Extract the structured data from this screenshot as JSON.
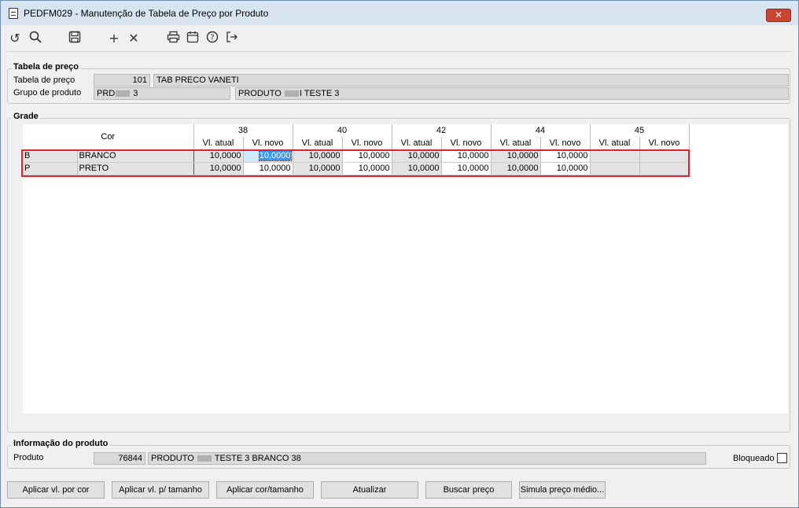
{
  "window": {
    "title": "PEDFM029 - Manutenção de Tabela de Preço por Produto",
    "close_label": "✕"
  },
  "toolbar": {
    "icons": [
      "refresh-icon",
      "search-icon",
      "save-icon",
      "add-icon",
      "delete-icon",
      "print-icon",
      "calendar-icon",
      "help-icon",
      "exit-icon"
    ]
  },
  "tabela_preco": {
    "legend": "Tabela de preço",
    "tabela_label": "Tabela de preço",
    "tabela_code": "101",
    "tabela_name": "TAB PRECO VANETI",
    "grupo_label": "Grupo de produto",
    "grupo_code_prefix": "PRD",
    "grupo_code_suffix": "3",
    "grupo_name_prefix": "PRODUTO",
    "grupo_name_suffix": "I TESTE 3"
  },
  "grade": {
    "legend": "Grade",
    "cor_header": "Cor",
    "sizes": [
      "38",
      "40",
      "42",
      "44",
      "45"
    ],
    "sub_atual": "Vl. atual",
    "sub_novo": "Vl. novo",
    "rows": [
      {
        "code": "B",
        "name": "BRANCO",
        "values": [
          "10,0000",
          "10,0000",
          "10,0000",
          "10,0000",
          "10,0000",
          "10,0000",
          "10,0000",
          "10,0000",
          "",
          ""
        ]
      },
      {
        "code": "P",
        "name": "PRETO",
        "values": [
          "10,0000",
          "10,0000",
          "10,0000",
          "10,0000",
          "10,0000",
          "10,0000",
          "10,0000",
          "10,0000",
          "",
          ""
        ]
      }
    ]
  },
  "produto_info": {
    "legend": "Informação do produto",
    "produto_label": "Produto",
    "produto_code": "76844",
    "produto_name_prefix": "PRODUTO",
    "produto_name_suffix": "TESTE 3 BRANCO 38",
    "bloqueado_label": "Bloqueado"
  },
  "buttons": {
    "aplicar_cor": "Aplicar vl. por cor",
    "aplicar_tamanho": "Aplicar vl. p/ tamanho",
    "aplicar_cor_tamanho": "Aplicar cor/tamanho",
    "atualizar": "Atualizar",
    "buscar_preco": "Buscar preço",
    "simula_preco": "Simula preço médio..."
  },
  "colors": {
    "highlight_box": "#e0242b",
    "selection": "#3399ff"
  }
}
